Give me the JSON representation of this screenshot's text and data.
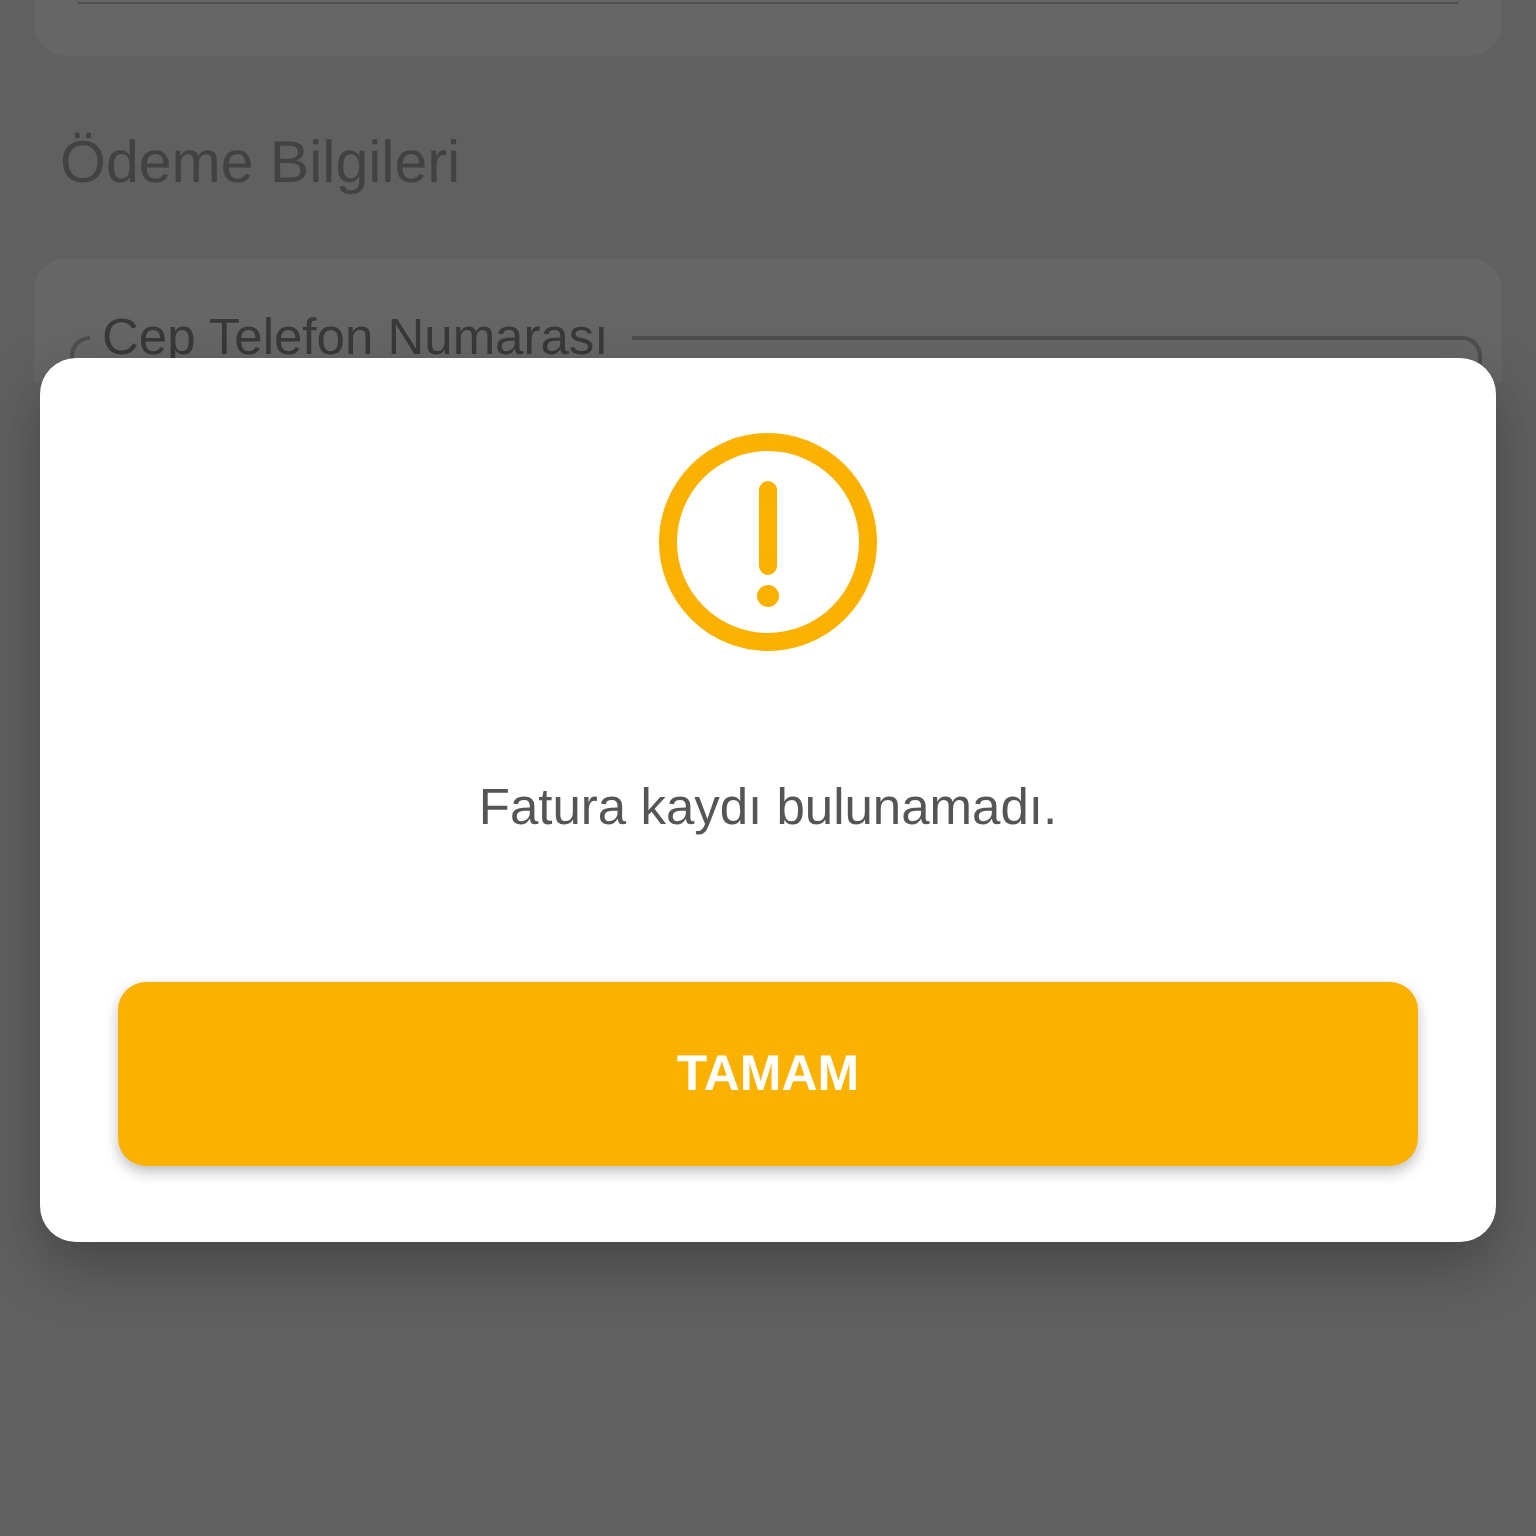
{
  "page": {
    "section_title": "Ödeme Bilgileri",
    "phone_field": {
      "label": "Cep Telefon Numarası"
    }
  },
  "dialog": {
    "kind": "warning",
    "message": "Fatura kaydı bulunamadı.",
    "button": "TAMAM"
  }
}
